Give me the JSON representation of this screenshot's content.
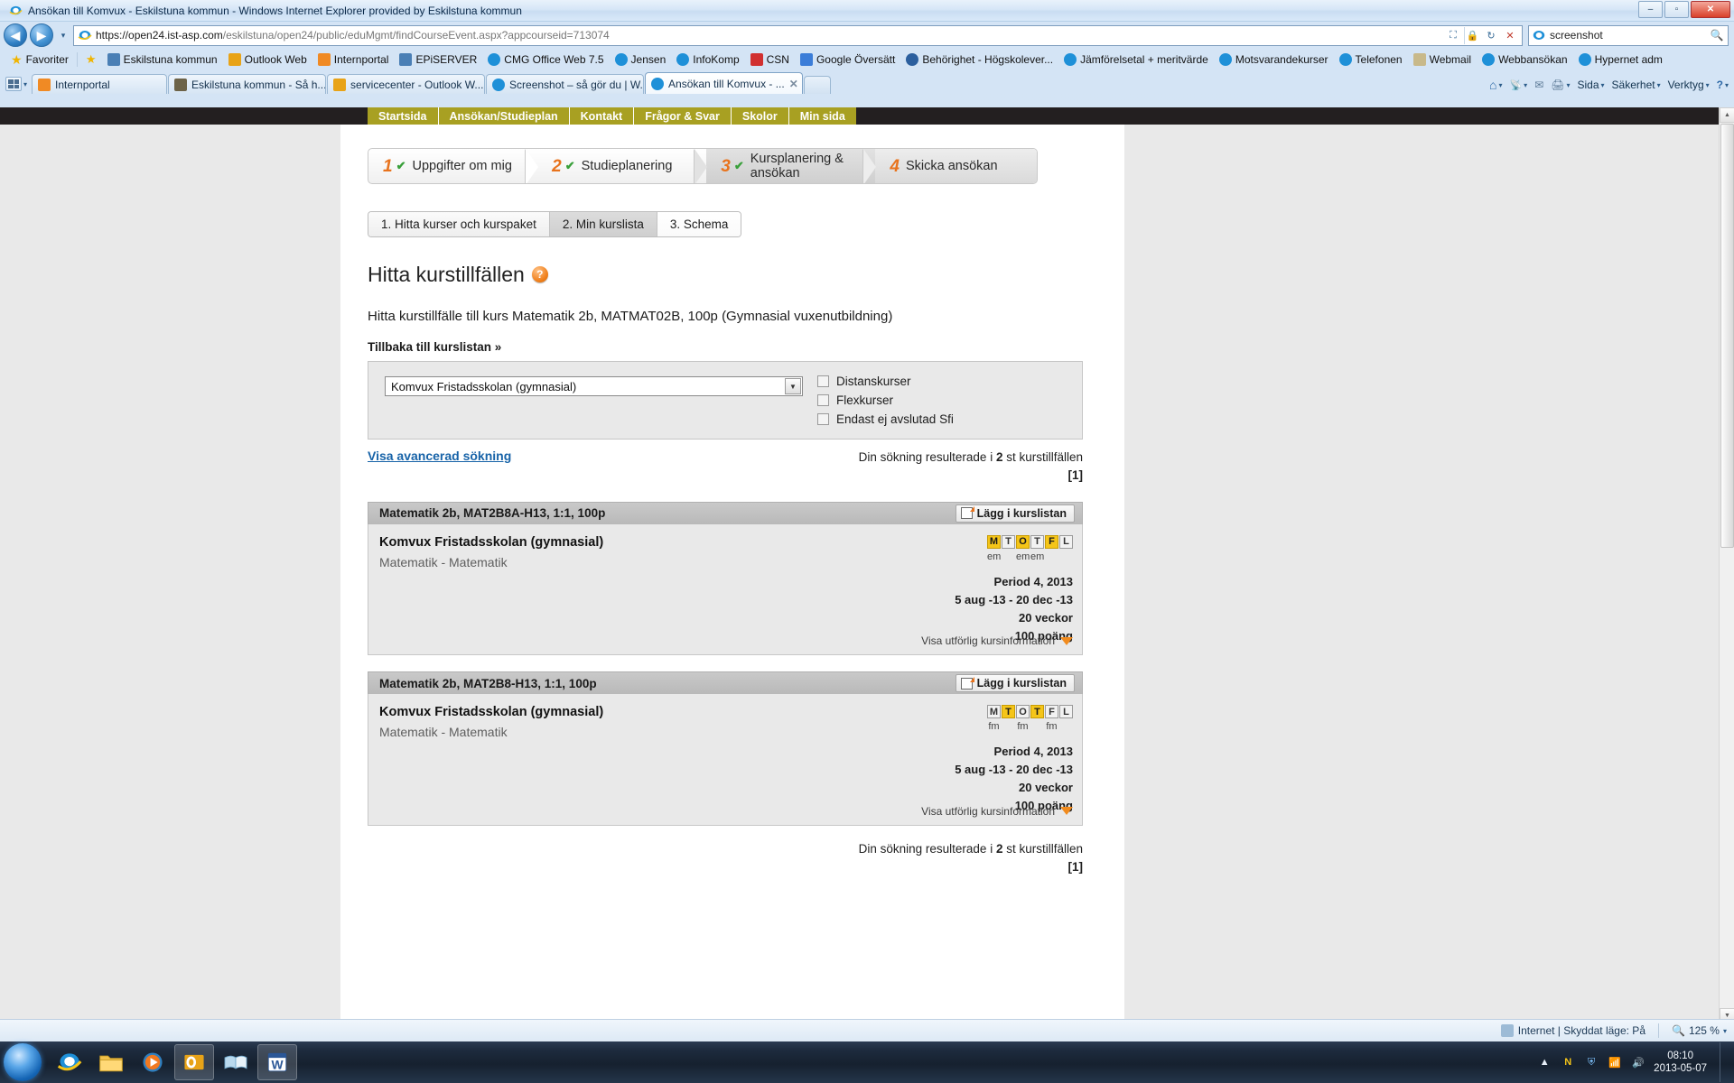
{
  "window": {
    "title": "Ansökan till Komvux - Eskilstuna kommun - Windows Internet Explorer provided by Eskilstuna kommun",
    "minimize": "–",
    "maximize": "▫",
    "close": "✕"
  },
  "address_bar": {
    "url_protocol": "https://",
    "url_domain": "open24.ist-asp.com",
    "url_path": "/eskilstuna/open24/public/eduMgmt/findCourseEvent.aspx?appcourseid=713074",
    "back_glyph": "◀",
    "forward_glyph": "▶",
    "history_caret": "▾",
    "refresh_glyph": "↻",
    "stop_glyph": "✕",
    "compat_glyph": "⛶",
    "lock_glyph": "🔒",
    "search_value": "screenshot",
    "search_glyph": "🔍"
  },
  "favorites": {
    "label": "Favoriter",
    "star_glyph": "★",
    "items": [
      {
        "label": "Eskilstuna kommun",
        "icon": "site-icon",
        "color": "#4a7fb5"
      },
      {
        "label": "Outlook Web",
        "icon": "outlook-icon",
        "color": "#e8a317"
      },
      {
        "label": "Internportal",
        "icon": "portal-icon",
        "color": "#f08a24"
      },
      {
        "label": "EPiSERVER",
        "icon": "site-icon",
        "color": "#4a7fb5"
      },
      {
        "label": "CMG Office Web 7.5",
        "icon": "ie-icon",
        "color": "#1e90d8"
      },
      {
        "label": "Jensen",
        "icon": "ie-icon",
        "color": "#1e90d8"
      },
      {
        "label": "InfoKomp",
        "icon": "ie-icon",
        "color": "#1e90d8"
      },
      {
        "label": "CSN",
        "icon": "csn-icon",
        "color": "#d13030"
      },
      {
        "label": "Google Översätt",
        "icon": "translate-icon",
        "color": "#3b7dd8"
      },
      {
        "label": "Behörighet - Högskolever...",
        "icon": "globe-icon",
        "color": "#2b5f9e"
      },
      {
        "label": "Jämförelsetal + meritvärde",
        "icon": "ie-icon",
        "color": "#1e90d8"
      },
      {
        "label": "Motsvarandekurser",
        "icon": "ie-icon",
        "color": "#1e90d8"
      },
      {
        "label": "Telefonen",
        "icon": "ie-icon",
        "color": "#1e90d8"
      },
      {
        "label": "Webmail",
        "icon": "mail-icon",
        "color": "#c8b98a"
      },
      {
        "label": "Webbansökan",
        "icon": "ie-icon",
        "color": "#1e90d8"
      },
      {
        "label": "Hypernet adm",
        "icon": "ie-icon",
        "color": "#1e90d8"
      }
    ]
  },
  "tabs": {
    "quick_tabs_glyph": "▦",
    "quick_caret": "▾",
    "items": [
      {
        "label": "Internportal",
        "active": false,
        "icon_color": "#f08a24"
      },
      {
        "label": "Eskilstuna kommun - Så h...",
        "active": false,
        "icon_color": "#6d6348"
      },
      {
        "label": "servicecenter - Outlook W...",
        "active": false,
        "icon_color": "#e8a317"
      },
      {
        "label": "Screenshot – så gör du | W...",
        "active": false,
        "icon_color": "#1e90d8"
      },
      {
        "label": "Ansökan till Komvux - ...",
        "active": true,
        "icon_color": "#1e90d8",
        "close_glyph": "✕"
      }
    ],
    "toolbar_right": {
      "home_glyph": "⌂",
      "home_caret": "▾",
      "feeds_glyph": "📡",
      "feeds_caret": "▾",
      "mail_glyph": "✉",
      "print_glyph": "🖨",
      "print_caret": "▾",
      "page_label": "Sida",
      "page_caret": "▾",
      "safety_label": "Säkerhet",
      "safety_caret": "▾",
      "tools_label": "Verktyg",
      "tools_caret": "▾",
      "help_glyph": "?",
      "help_caret": "▾"
    }
  },
  "site_nav": {
    "items": [
      "Startsida",
      "Ansökan/Studieplan",
      "Kontakt",
      "Frågor & Svar",
      "Skolor",
      "Min sida"
    ],
    "accent": "#a8a022"
  },
  "steps": [
    {
      "num": "1",
      "label": "Uppgifter om mig",
      "done": true
    },
    {
      "num": "2",
      "label": "Studieplanering",
      "done": true
    },
    {
      "num": "3",
      "label": "Kursplanering & ansökan",
      "done": true
    },
    {
      "num": "4",
      "label": "Skicka ansökan",
      "done": false
    }
  ],
  "step_check_glyph": "✔",
  "subtabs": [
    {
      "label": "1. Hitta kurser och kurspaket",
      "selected": false
    },
    {
      "label": "2. Min kurslista",
      "selected": true
    },
    {
      "label": "3. Schema",
      "selected": false
    }
  ],
  "main": {
    "page_title": "Hitta kurstillfällen",
    "help_glyph": "?",
    "subheading": "Hitta kurstillfälle till kurs Matematik 2b, MATMAT02B, 100p (Gymnasial vuxenutbildning)",
    "back_link": "Tillbaka till kurslistan »",
    "school_select_value": "Komvux Fristadsskolan (gymnasial)",
    "select_caret": "▼",
    "checkboxes": [
      {
        "label": "Distanskurser",
        "checked": false
      },
      {
        "label": "Flexkurser",
        "checked": false
      },
      {
        "label": "Endast ej avslutad Sfi",
        "checked": false
      }
    ],
    "advanced_link": "Visa avancerad sökning",
    "result_text_prefix": "Din sökning resulterade i ",
    "result_count": "2",
    "result_text_suffix": " st kurstillfällen",
    "page_indicator": "[1]",
    "add_button_label": "Lägg i kurslistan",
    "more_info_label": "Visa utförlig kursinformation"
  },
  "courses": [
    {
      "header": "Matematik 2b, MAT2B8A-H13, 1:1, 100p",
      "school": "Komvux Fristadsskolan (gymnasial)",
      "subject": "Matematik - Matematik",
      "days": [
        {
          "letter": "M",
          "active": true
        },
        {
          "letter": "T",
          "active": false
        },
        {
          "letter": "O",
          "active": true
        },
        {
          "letter": "T",
          "active": false
        },
        {
          "letter": "F",
          "active": true
        },
        {
          "letter": "L",
          "active": false
        }
      ],
      "day_times": [
        "em",
        "",
        "em",
        "em",
        "",
        ""
      ],
      "period": "Period 4, 2013",
      "dates": "5 aug -13 - 20 dec -13",
      "weeks": "20 veckor",
      "points": "100 poäng"
    },
    {
      "header": "Matematik 2b, MAT2B8-H13, 1:1, 100p",
      "school": "Komvux Fristadsskolan (gymnasial)",
      "subject": "Matematik - Matematik",
      "days": [
        {
          "letter": "M",
          "active": false
        },
        {
          "letter": "T",
          "active": true
        },
        {
          "letter": "O",
          "active": false
        },
        {
          "letter": "T",
          "active": true
        },
        {
          "letter": "F",
          "active": false
        },
        {
          "letter": "L",
          "active": false
        }
      ],
      "day_times": [
        "fm",
        "",
        "fm",
        "",
        "fm",
        ""
      ],
      "period": "Period 4, 2013",
      "dates": "5 aug -13 - 20 dec -13",
      "weeks": "20 veckor",
      "points": "100 poäng"
    }
  ],
  "footer_result": {
    "prefix": "Din sökning resulterade i ",
    "count": "2",
    "suffix": " st kurstillfällen",
    "page_indicator": "[1]"
  },
  "status_bar": {
    "zone_text": "Internet | Skyddat läge: På",
    "zoom_glyph": "🔍",
    "zoom_level": "125 %",
    "zoom_caret": "▾"
  },
  "taskbar": {
    "items": [
      {
        "name": "internet-explorer",
        "glyph": "e",
        "color": "#1e90d8",
        "active": false
      },
      {
        "name": "explorer-folder",
        "glyph": "▬",
        "color": "#f0c14b",
        "active": false
      },
      {
        "name": "media-player",
        "glyph": "▶",
        "color": "#3a9ad9",
        "active": false
      },
      {
        "name": "outlook",
        "glyph": "O",
        "color": "#e8a317",
        "active": true
      },
      {
        "name": "books-app",
        "glyph": "📚",
        "color": "#6fb6dd",
        "active": false
      },
      {
        "name": "word",
        "glyph": "W",
        "color": "#2b5797",
        "active": true
      }
    ],
    "tray": {
      "arrow_glyph": "▲",
      "norton_glyph": "N",
      "shield_glyph": "⛨",
      "network_glyph": "📶",
      "volume_glyph": "🔊",
      "time": "08:10",
      "date": "2013-05-07"
    }
  }
}
